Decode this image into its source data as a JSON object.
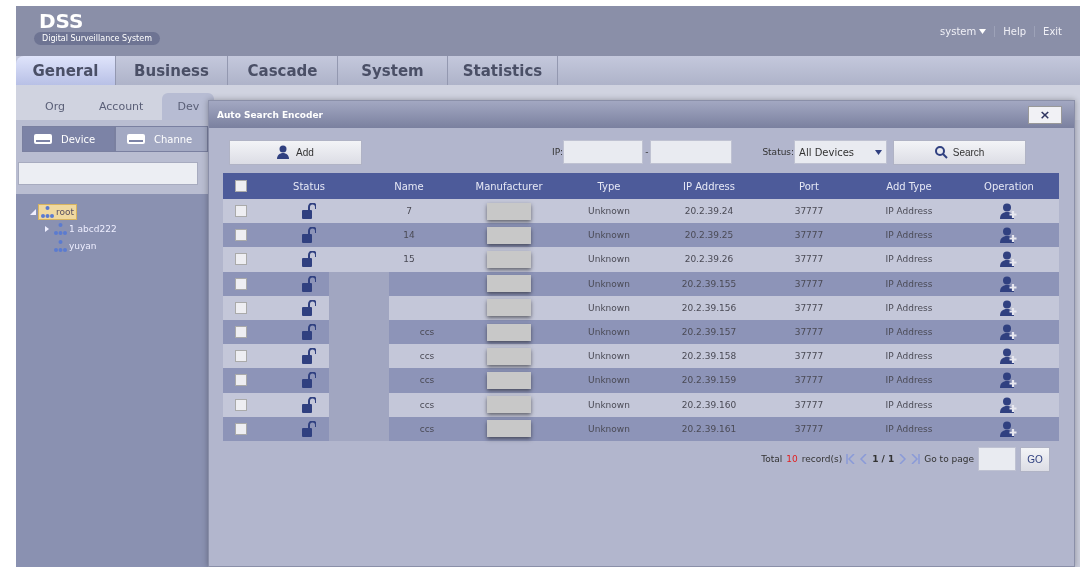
{
  "header": {
    "logo": "DSS",
    "subtitle": "Digital Surveillance System",
    "user_menu": "system",
    "links": [
      "Help",
      "Exit"
    ]
  },
  "tabs": [
    {
      "label": "General",
      "selected": true
    },
    {
      "label": "Business",
      "selected": false
    },
    {
      "label": "Cascade",
      "selected": false
    },
    {
      "label": "System",
      "selected": false
    },
    {
      "label": "Statistics",
      "selected": false
    }
  ],
  "subtabs": [
    {
      "label": "Org",
      "selected": false
    },
    {
      "label": "Account",
      "selected": false
    },
    {
      "label": "Dev",
      "selected": true
    }
  ],
  "device_tabs": [
    {
      "label": "Device",
      "selected": true
    },
    {
      "label": "Channe",
      "selected": false
    }
  ],
  "tree": [
    {
      "label": "root",
      "selected": true,
      "expanded": true,
      "children": [
        {
          "label": "1 abcd222",
          "expanded": false,
          "selected": false
        },
        {
          "label": "yuyan",
          "selected": false
        }
      ]
    }
  ],
  "dialog": {
    "title": "Auto Search Encoder",
    "close_button": "×",
    "add_button": "Add",
    "ip_label": "IP:",
    "ip_separator": "-",
    "status_label": "Status:",
    "status_value": "All Devices",
    "search_button": "Search",
    "columns": [
      "Status",
      "Name",
      "Manufacturer",
      "Type",
      "IP Address",
      "Port",
      "Add Type",
      "Operation"
    ],
    "header_checked": false,
    "rows": [
      {
        "checked": false,
        "locked": false,
        "name": "7",
        "name_redacted": false,
        "type": "Unknown",
        "ip": "20.2.39.24",
        "port": "37777",
        "add_type": "IP Address"
      },
      {
        "checked": false,
        "locked": false,
        "name": "14",
        "name_redacted": false,
        "type": "Unknown",
        "ip": "20.2.39.25",
        "port": "37777",
        "add_type": "IP Address"
      },
      {
        "checked": false,
        "locked": false,
        "name": "15",
        "name_redacted": false,
        "type": "Unknown",
        "ip": "20.2.39.26",
        "port": "37777",
        "add_type": "IP Address"
      },
      {
        "checked": false,
        "locked": false,
        "name_redacted": true,
        "type": "Unknown",
        "ip": "20.2.39.155",
        "port": "37777",
        "add_type": "IP Address"
      },
      {
        "checked": false,
        "locked": false,
        "name_redacted": true,
        "type": "Unknown",
        "ip": "20.2.39.156",
        "port": "37777",
        "add_type": "IP Address"
      },
      {
        "checked": false,
        "locked": false,
        "name": "ccs",
        "name_redacted": true,
        "type": "Unknown",
        "ip": "20.2.39.157",
        "port": "37777",
        "add_type": "IP Address"
      },
      {
        "checked": false,
        "locked": false,
        "name": "ccs",
        "name_redacted": true,
        "type": "Unknown",
        "ip": "20.2.39.158",
        "port": "37777",
        "add_type": "IP Address"
      },
      {
        "checked": false,
        "locked": false,
        "name": "ccs",
        "name_redacted": true,
        "type": "Unknown",
        "ip": "20.2.39.159",
        "port": "37777",
        "add_type": "IP Address"
      },
      {
        "checked": false,
        "locked": false,
        "name": "ccs",
        "name_redacted": true,
        "type": "Unknown",
        "ip": "20.2.39.160",
        "port": "37777",
        "add_type": "IP Address"
      },
      {
        "checked": false,
        "locked": false,
        "name": "ccs",
        "name_redacted": true,
        "type": "Unknown",
        "ip": "20.2.39.161",
        "port": "37777",
        "add_type": "IP Address"
      }
    ],
    "footer": {
      "total_label": "Total",
      "total": "10",
      "records_label": "record(s)",
      "page": "1 / 1",
      "goto_label": "Go to page",
      "go_button": "GO"
    }
  }
}
